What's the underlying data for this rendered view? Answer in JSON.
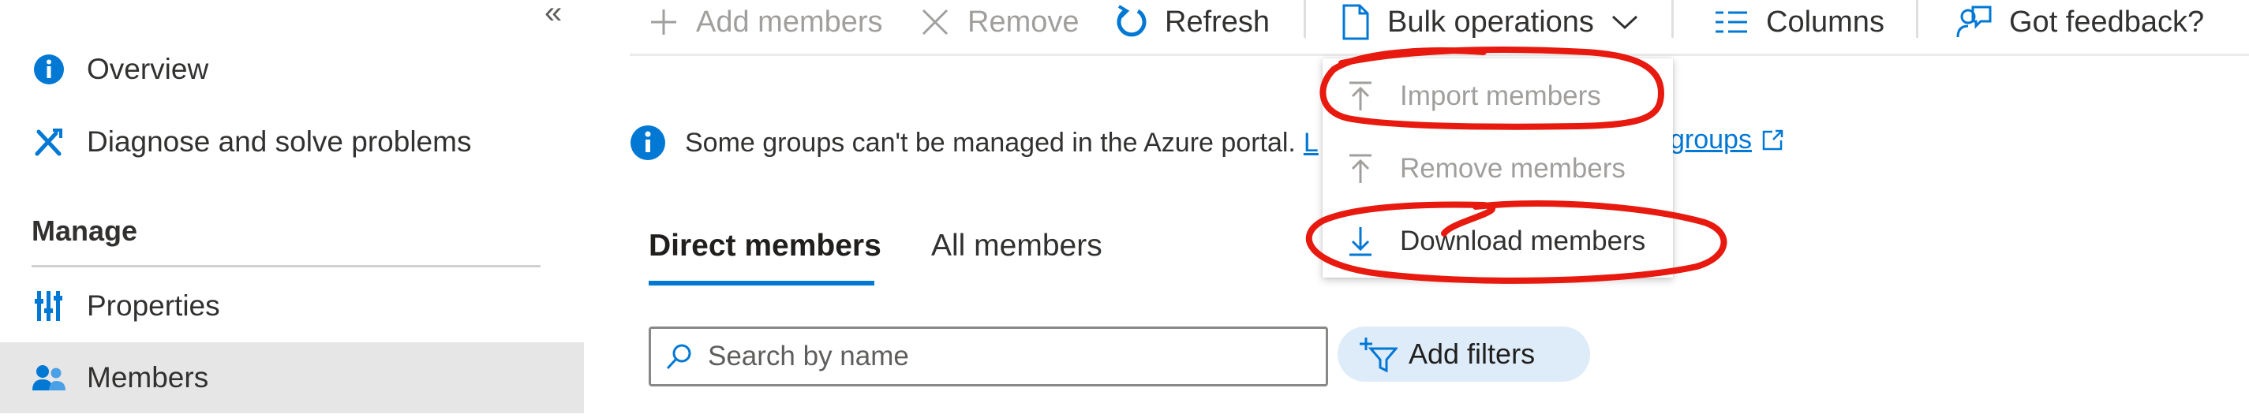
{
  "sidebar": {
    "collapse_glyph": "«",
    "items": [
      {
        "label": "Overview",
        "icon": "info-icon"
      },
      {
        "label": "Diagnose and solve problems",
        "icon": "wrench-icon"
      }
    ],
    "section_title": "Manage",
    "manage_items": [
      {
        "label": "Properties",
        "icon": "properties-icon"
      },
      {
        "label": "Members",
        "icon": "members-icon",
        "selected": true
      }
    ]
  },
  "toolbar": {
    "add_members": "Add members",
    "remove": "Remove",
    "refresh": "Refresh",
    "bulk_operations": "Bulk operations",
    "columns": "Columns",
    "feedback": "Got feedback?"
  },
  "info_bar": {
    "text": "Some groups can't be managed in the Azure portal.",
    "link_start": "L",
    "link_end": "groups"
  },
  "tabs": [
    {
      "label": "Direct members",
      "active": true
    },
    {
      "label": "All members",
      "active": false
    }
  ],
  "search": {
    "placeholder": "Search by name"
  },
  "add_filters": "Add filters",
  "bulk_menu": {
    "items": [
      {
        "label": "Import members",
        "enabled": false
      },
      {
        "label": "Remove members",
        "enabled": false
      },
      {
        "label": "Download members",
        "enabled": true
      }
    ]
  },
  "colors": {
    "accent": "#0078d4",
    "annotation": "#e8190e",
    "selected_bg": "#e6e6e6"
  }
}
